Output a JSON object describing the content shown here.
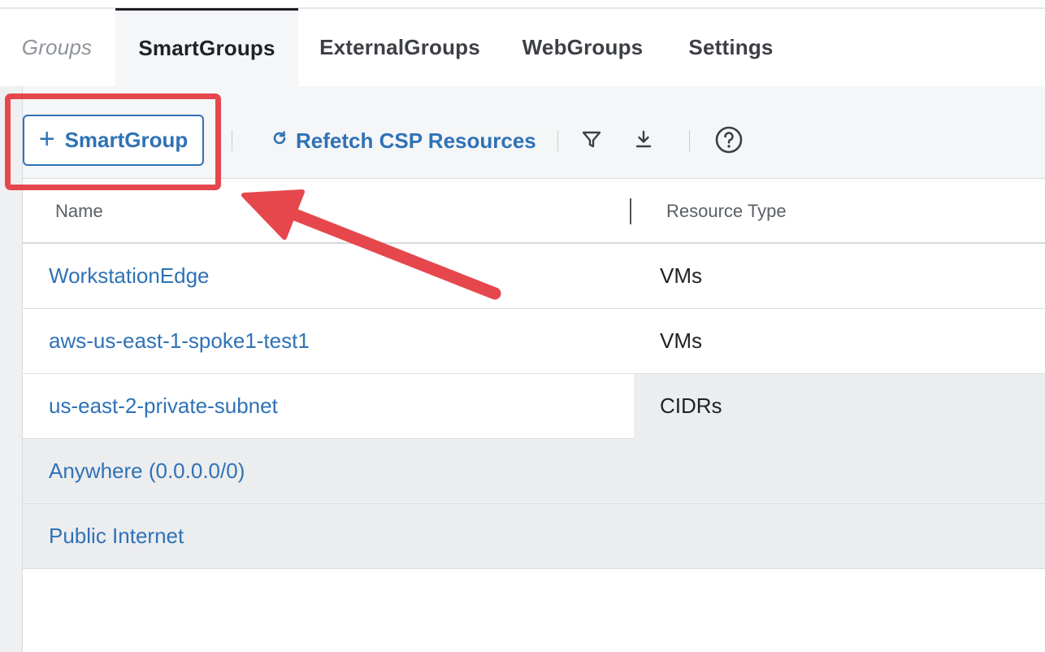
{
  "tabs": {
    "section_label": "Groups",
    "items": [
      {
        "label": "SmartGroups",
        "active": true
      },
      {
        "label": "ExternalGroups"
      },
      {
        "label": "WebGroups"
      },
      {
        "label": "Settings"
      }
    ]
  },
  "toolbar": {
    "add_label": "SmartGroup",
    "refetch_label": "Refetch CSP Resources",
    "icons": [
      "filter-icon",
      "download-icon",
      "help-icon"
    ]
  },
  "table": {
    "columns": [
      "Name",
      "Resource Type"
    ],
    "rows": [
      {
        "name": "WorkstationEdge",
        "type": "VMs"
      },
      {
        "name": "aws-us-east-1-spoke1-test1",
        "type": "VMs"
      },
      {
        "name": "us-east-2-private-subnet",
        "type": "CIDRs"
      },
      {
        "name": "Anywhere (0.0.0.0/0)",
        "type": ""
      },
      {
        "name": "Public Internet",
        "type": ""
      }
    ]
  },
  "colors": {
    "accent": "#2f72b6",
    "annotation": "#e5474d"
  }
}
